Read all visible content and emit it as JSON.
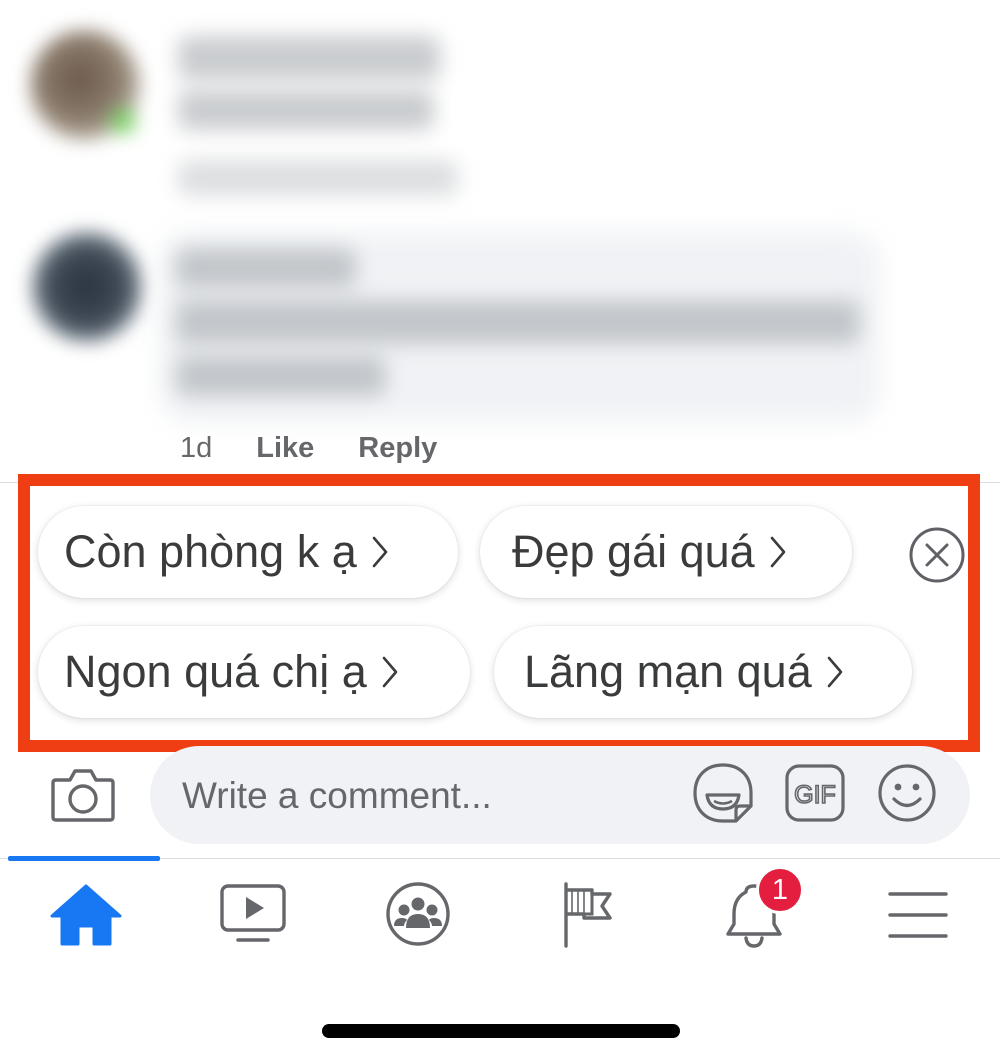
{
  "comments": [
    {
      "author": "",
      "text": "",
      "time": "",
      "like_label": "",
      "reply_label": ""
    },
    {
      "author": "",
      "text": "",
      "time": "1d",
      "like_label": "Like",
      "reply_label": "Reply"
    }
  ],
  "quick_replies": [
    {
      "label": "Còn phòng k ạ"
    },
    {
      "label": "Đẹp gái quá"
    },
    {
      "label": "Ngon quá chị ạ"
    },
    {
      "label": "Lãng mạn quá"
    }
  ],
  "composer": {
    "placeholder": "Write a comment...",
    "gif_label": "GIF",
    "icons": [
      "camera-icon",
      "sticker-icon",
      "gif-icon",
      "emoji-icon"
    ]
  },
  "bottom_nav": {
    "items": [
      "home",
      "watch",
      "groups",
      "pages",
      "notifications",
      "menu"
    ],
    "active": "home",
    "notification_badge": "1"
  },
  "colors": {
    "accent": "#1877f2",
    "highlight_border": "#f03e14",
    "badge": "#e41e3f",
    "icon_gray": "#65676b"
  }
}
